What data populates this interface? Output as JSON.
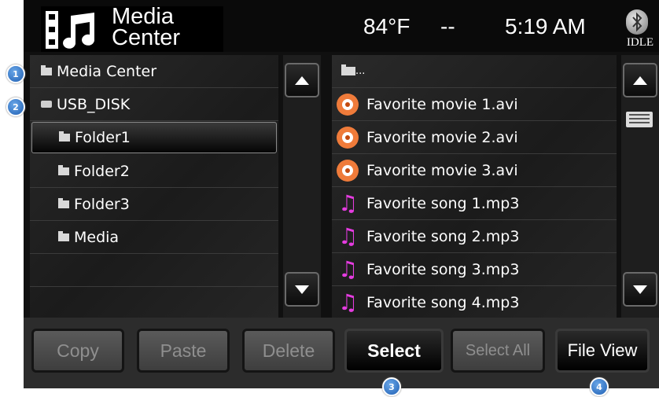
{
  "header": {
    "logo_line1": "Media",
    "logo_line2": "Center",
    "temperature": "84°F",
    "separator": "--",
    "time": "5:19 AM",
    "bluetooth_status": "IDLE"
  },
  "left_list": {
    "items": [
      {
        "label": "Media Center",
        "icon": "folder-icon"
      },
      {
        "label": "USB_DISK",
        "icon": "usb-drive-icon"
      },
      {
        "label": "Folder1",
        "icon": "folder-icon",
        "selected": true
      },
      {
        "label": "Folder2",
        "icon": "folder-icon"
      },
      {
        "label": "Folder3",
        "icon": "folder-icon"
      },
      {
        "label": "Media",
        "icon": "folder-icon"
      }
    ]
  },
  "right_list": {
    "parent_label": "...",
    "items": [
      {
        "label": "Favorite movie 1.avi",
        "icon": "film-reel-icon"
      },
      {
        "label": "Favorite movie 2.avi",
        "icon": "film-reel-icon"
      },
      {
        "label": "Favorite movie 3.avi",
        "icon": "film-reel-icon"
      },
      {
        "label": "Favorite song 1.mp3",
        "icon": "music-note-icon"
      },
      {
        "label": "Favorite song 2.mp3",
        "icon": "music-note-icon"
      },
      {
        "label": "Favorite song 3.mp3",
        "icon": "music-note-icon"
      },
      {
        "label": "Favorite song 4.mp3",
        "icon": "music-note-icon"
      }
    ]
  },
  "toolbar": {
    "copy": "Copy",
    "paste": "Paste",
    "delete": "Delete",
    "select": "Select",
    "select_all": "Select All",
    "file_view": "File View"
  },
  "callouts": [
    "1",
    "2",
    "3",
    "4"
  ],
  "colors": {
    "movie_icon": "#ef7b3a",
    "music_icon": "#e53ce0",
    "callout": "#2e6fc4"
  }
}
